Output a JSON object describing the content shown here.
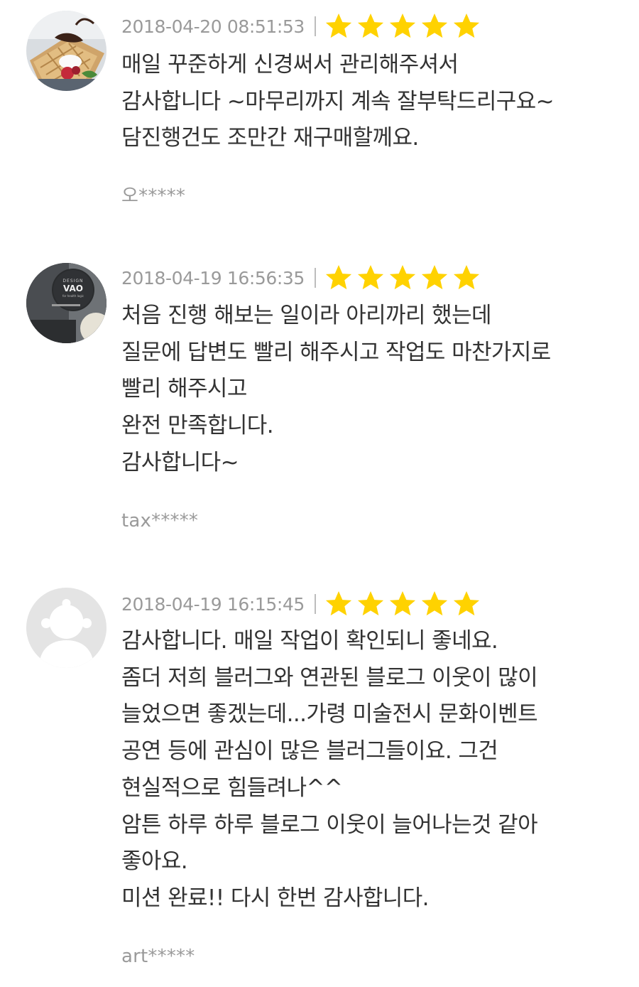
{
  "reviews": [
    {
      "avatar": "waffle-dessert-photo",
      "date": "2018-04-20 08:51:53",
      "rating": 5,
      "lines": [
        "매일 꾸준하게 신경써서 관리해주셔서",
        "감사합니다 ~마무리까지 계속 잘부탁드리구요~",
        "담진행건도 조만간 재구매할께요."
      ],
      "author": "오*****"
    },
    {
      "avatar": "design-vao-logo-photo",
      "avatar_text": [
        "DESIGN",
        "VAO",
        "for health logic"
      ],
      "date": "2018-04-19 16:56:35",
      "rating": 5,
      "lines": [
        "처음 진행 해보는 일이라 아리까리 했는데",
        "질문에 답변도 빨리 해주시고 작업도 마찬가지로",
        "빨리 해주시고",
        "완전 만족합니다.",
        "감사합니다~"
      ],
      "author": "tax*****"
    },
    {
      "avatar": "default-profile-icon",
      "date": "2018-04-19 16:15:45",
      "rating": 5,
      "lines": [
        "감사합니다. 매일 작업이 확인되니 좋네요.",
        "좀더 저희 블러그와 연관된 블로그  이웃이 많이",
        "늘었으면 좋겠는데...가령 미술전시  문화이벤트",
        "공연 등에 관심이 많은 블러그들이요. 그건",
        "현실적으로 힘들려나^^",
        "암튼 하루 하루 블로그 이웃이 늘어나는것 같아",
        "좋아요.",
        "미션 완료!! 다시 한번 감사합니다."
      ],
      "author": "art*****"
    }
  ],
  "colors": {
    "star": "#ffd200",
    "meta_text": "#9a9a9a",
    "body_text": "#333333",
    "separator": "#bdbdbd"
  },
  "icons": {
    "star": "star-icon",
    "separator": "vertical-bar"
  }
}
